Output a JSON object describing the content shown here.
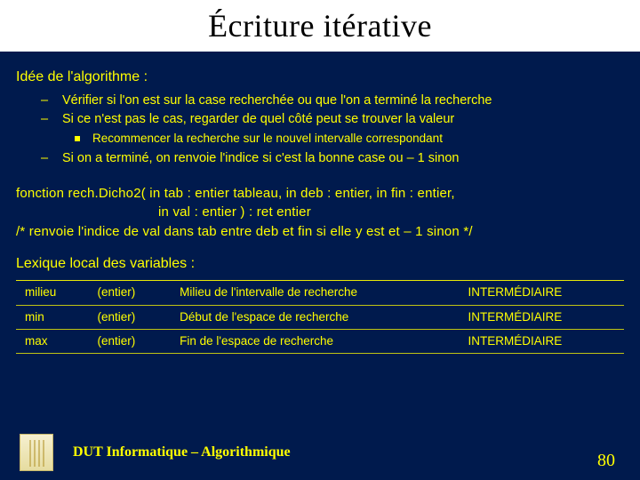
{
  "title": "Écriture itérative",
  "intro": "Idée de l'algorithme :",
  "bullets": {
    "items": [
      "Vérifier si l'on est sur la case recherchée ou que l'on a terminé la recherche",
      "Si ce n'est pas le cas, regarder de quel côté peut se trouver la valeur"
    ],
    "sub": "Recommencer la recherche sur le nouvel intervalle correspondant",
    "after": "Si on a terminé, on renvoie l'indice si c'est la bonne case ou – 1 sinon"
  },
  "signature": {
    "line1": "fonction rech.Dicho2( in tab : entier tableau, in deb : entier, in fin : entier,",
    "line2": "in val : entier ) : ret entier",
    "comment": "/* renvoie l'indice de val dans tab entre deb et fin si elle y est et – 1 sinon */"
  },
  "lexique_title": "Lexique local des variables :",
  "vars": [
    {
      "name": "milieu",
      "type": "(entier)",
      "desc": "Milieu de l'intervalle de recherche",
      "role": "INTERMÉDIAIRE"
    },
    {
      "name": "min",
      "type": "(entier)",
      "desc": "Début de l'espace de recherche",
      "role": "INTERMÉDIAIRE"
    },
    {
      "name": "max",
      "type": "(entier)",
      "desc": "Fin de l'espace de recherche",
      "role": "INTERMÉDIAIRE"
    }
  ],
  "footer": "DUT Informatique – Algorithmique",
  "page": "80"
}
